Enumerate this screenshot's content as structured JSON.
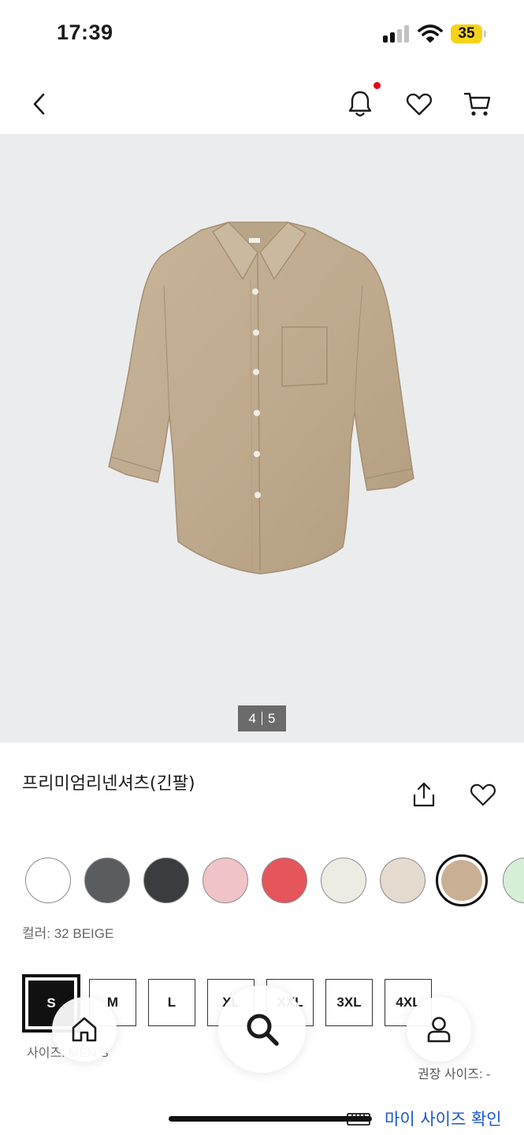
{
  "status_bar": {
    "time": "17:39",
    "battery": "35"
  },
  "colors": {
    "accent_link": "#1a56c9",
    "notification_dot": "#e60012",
    "battery": "#f7d21a"
  },
  "header": {
    "icons": [
      "back-icon",
      "bell-icon",
      "heart-icon",
      "cart-icon"
    ],
    "has_notification": true
  },
  "gallery": {
    "current": "4",
    "total": "5"
  },
  "product": {
    "title": "프리미엄리넨셔츠(긴팔)",
    "color_label": "컬러: 32 BEIGE"
  },
  "swatches": [
    {
      "color": "#ffffff",
      "selected": false
    },
    {
      "color": "#5a5c5e",
      "selected": false
    },
    {
      "color": "#3a3c3f",
      "selected": false
    },
    {
      "color": "#f0c3c9",
      "selected": false
    },
    {
      "color": "#e5555c",
      "selected": false
    },
    {
      "color": "#ecebe4",
      "selected": false
    },
    {
      "color": "#e4dace",
      "selected": false
    },
    {
      "color": "#c9b095",
      "selected": true
    },
    {
      "color": "#d6efd7",
      "selected": false
    }
  ],
  "sizes": [
    {
      "label": "S",
      "selected": true
    },
    {
      "label": "M",
      "selected": false
    },
    {
      "label": "L",
      "selected": false
    },
    {
      "label": "XL",
      "selected": false
    },
    {
      "label": "XXL",
      "selected": false
    },
    {
      "label": "3XL",
      "selected": false
    },
    {
      "label": "4XL",
      "selected": false
    }
  ],
  "size_info": {
    "label": "사이즈: MEN S",
    "recommended": "권장 사이즈: -",
    "my_size_link": "마이 사이즈 확인"
  },
  "bottom_nav": [
    "home-icon",
    "search-icon",
    "account-icon"
  ]
}
